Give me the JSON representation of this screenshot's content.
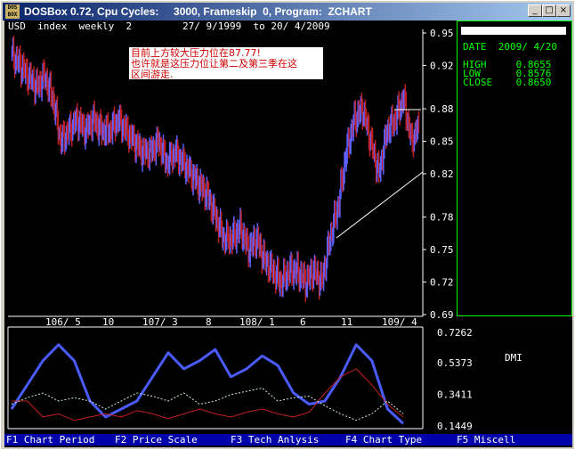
{
  "window": {
    "icon_text": "DOS BOX",
    "title": "DOSBox 0.72, Cpu Cycles:     3000, Frameskip  0, Program:  ZCHART",
    "buttons": [
      "_",
      "□",
      "×"
    ]
  },
  "header": {
    "symbol": "USD  index  weekly  2",
    "range": "27/ 9/1999  to 20/ 4/2009"
  },
  "price_axis": {
    "ticks": [
      "0.95",
      "0.92",
      "0.88",
      "0.85",
      "0.82",
      "0.78",
      "0.75",
      "0.72",
      "0.69"
    ]
  },
  "time_axis": {
    "ticks": [
      "106/ 5",
      "10",
      "107/ 3",
      "8",
      "108/ 1",
      "6",
      "11",
      "109/ 4"
    ]
  },
  "info": {
    "date": "DATE  2009/ 4/20",
    "high": "HIGH     0.8655",
    "low": "LOW      0.8576",
    "close": "CLOSE    0.8650"
  },
  "note": {
    "line1": "目前上方较大压力位在87.77!",
    "line2": "也许就是这压力位让第二及第三季在这",
    "line3": "区间游走."
  },
  "indicator": {
    "name": "DMI",
    "ticks": [
      "0.7262",
      "0.5373",
      "0.3411",
      "0.1449"
    ]
  },
  "function_keys": [
    "F1 Chart Period",
    "F2 Price Scale",
    "F3 Tech Anlysis",
    "F4 Chart Type",
    "F5 Miscell"
  ],
  "colors": {
    "up_bar": "#6060ff",
    "down_bar": "#c02020",
    "dmi_adx": "#4a5cff",
    "dmi_plus": "#c02020",
    "dmi_minus": "#d0f0d0",
    "function_bar": "#0000aa",
    "info_text": "#00ff00"
  },
  "chart_data": [
    {
      "type": "bar",
      "title": "USD  index  weekly  2",
      "ylim": [
        0.69,
        0.95
      ],
      "x": [
        "106/ 5",
        "10",
        "107/ 3",
        "8",
        "108/ 1",
        "6",
        "11",
        "109/ 4"
      ],
      "series": [
        {
          "close": [
            0.93,
            0.92,
            0.91,
            0.9,
            0.91,
            0.89,
            0.85,
            0.86,
            0.87,
            0.86,
            0.87,
            0.86,
            0.86,
            0.87,
            0.86,
            0.85,
            0.84,
            0.84,
            0.85,
            0.83,
            0.84,
            0.83,
            0.82,
            0.81,
            0.8,
            0.78,
            0.76,
            0.76,
            0.77,
            0.75,
            0.76,
            0.74,
            0.73,
            0.72,
            0.73,
            0.73,
            0.72,
            0.73,
            0.72,
            0.76,
            0.79,
            0.84,
            0.87,
            0.88,
            0.85,
            0.82,
            0.86,
            0.87,
            0.89,
            0.85,
            0.865
          ]
        }
      ]
    },
    {
      "type": "line",
      "title": "DMI",
      "ylim": [
        0.1449,
        0.7262
      ],
      "x": [
        "106/ 5",
        "10",
        "107/ 3",
        "8",
        "108/ 1",
        "6",
        "11",
        "109/ 4"
      ],
      "series": [
        {
          "values": [
            0.25,
            0.4,
            0.55,
            0.65,
            0.55,
            0.3,
            0.2,
            0.25,
            0.3,
            0.45,
            0.6,
            0.5,
            0.55,
            0.62,
            0.45,
            0.5,
            0.58,
            0.52,
            0.35,
            0.28,
            0.3,
            0.45,
            0.65,
            0.55,
            0.25,
            0.16
          ]
        },
        {
          "values": [
            0.3,
            0.3,
            0.2,
            0.22,
            0.18,
            0.2,
            0.22,
            0.2,
            0.24,
            0.22,
            0.19,
            0.22,
            0.25,
            0.22,
            0.2,
            0.23,
            0.25,
            0.22,
            0.2,
            0.23,
            0.35,
            0.45,
            0.5,
            0.4,
            0.28,
            0.2
          ]
        },
        {
          "values": [
            0.28,
            0.32,
            0.35,
            0.3,
            0.32,
            0.3,
            0.25,
            0.3,
            0.35,
            0.33,
            0.3,
            0.35,
            0.28,
            0.3,
            0.34,
            0.36,
            0.38,
            0.3,
            0.32,
            0.33,
            0.27,
            0.22,
            0.18,
            0.22,
            0.3,
            0.22
          ]
        }
      ]
    }
  ]
}
